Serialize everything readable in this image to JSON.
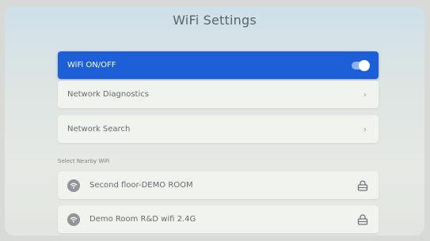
{
  "screen": {
    "title": "WiFi Settings"
  },
  "wifi_toggle": {
    "label": "WiFi ON/OFF",
    "state": "on"
  },
  "menu": {
    "diagnostics_label": "Network Diagnostics",
    "search_label": "Network Search",
    "chevron": "›"
  },
  "nearby": {
    "section_label": "Select Nearby WiFi",
    "networks": [
      {
        "ssid": "Second floor-DEMO ROOM",
        "secured": true
      },
      {
        "ssid": "Demo Room R&D wifi 2.4G",
        "secured": true
      }
    ]
  },
  "colors": {
    "accent": "#1d5fd6",
    "row_bg": "#f1f3ef",
    "icon_gray": "#8f9598"
  },
  "icons": [
    "wifi-icon",
    "lock-icon",
    "chevron-right-icon"
  ]
}
